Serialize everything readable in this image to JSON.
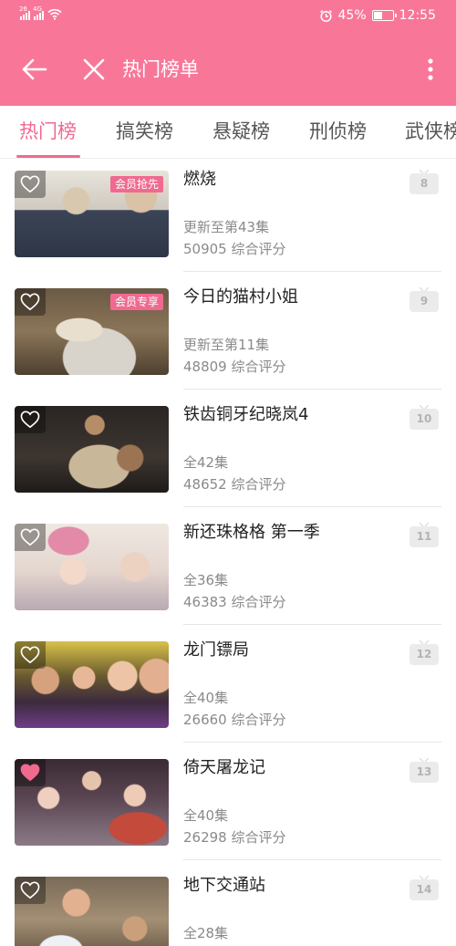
{
  "status_bar": {
    "signal_1_type": "26",
    "signal_2_type": "4G",
    "battery_level": "45%",
    "battery_fraction": 0.45,
    "time": "12:55",
    "icons": [
      "signal-icon",
      "wifi-icon",
      "alarm-icon",
      "battery-icon"
    ]
  },
  "header": {
    "title": "热门榜单",
    "icons": [
      "back-arrow-icon",
      "close-icon",
      "more-vertical-icon"
    ],
    "background_color": "#f87799"
  },
  "tabs": [
    {
      "label": "热门榜",
      "active": true
    },
    {
      "label": "搞笑榜",
      "active": false
    },
    {
      "label": "悬疑榜",
      "active": false
    },
    {
      "label": "刑侦榜",
      "active": false
    },
    {
      "label": "武侠榜",
      "active": false
    }
  ],
  "accent_color": "#f06a90",
  "items": [
    {
      "rank": "8",
      "title": "燃烧",
      "badge": "会员抢先",
      "episodes": "更新至第43集",
      "rating": "50905 综合评分",
      "favorited": false
    },
    {
      "rank": "9",
      "title": "今日的猫村小姐",
      "badge": "会员专享",
      "episodes": "更新至第11集",
      "rating": "48809 综合评分",
      "favorited": false
    },
    {
      "rank": "10",
      "title": "铁齿铜牙纪晓岚4",
      "badge": "",
      "episodes": "全42集",
      "rating": "48652 综合评分",
      "favorited": false
    },
    {
      "rank": "11",
      "title": "新还珠格格 第一季",
      "badge": "",
      "episodes": "全36集",
      "rating": "46383 综合评分",
      "favorited": false
    },
    {
      "rank": "12",
      "title": "龙门镖局",
      "badge": "",
      "episodes": "全40集",
      "rating": "26660 综合评分",
      "favorited": false
    },
    {
      "rank": "13",
      "title": "倚天屠龙记",
      "badge": "",
      "episodes": "全40集",
      "rating": "26298 综合评分",
      "favorited": true
    },
    {
      "rank": "14",
      "title": "地下交通站",
      "badge": "",
      "episodes": "全28集",
      "rating": "",
      "favorited": false
    }
  ]
}
